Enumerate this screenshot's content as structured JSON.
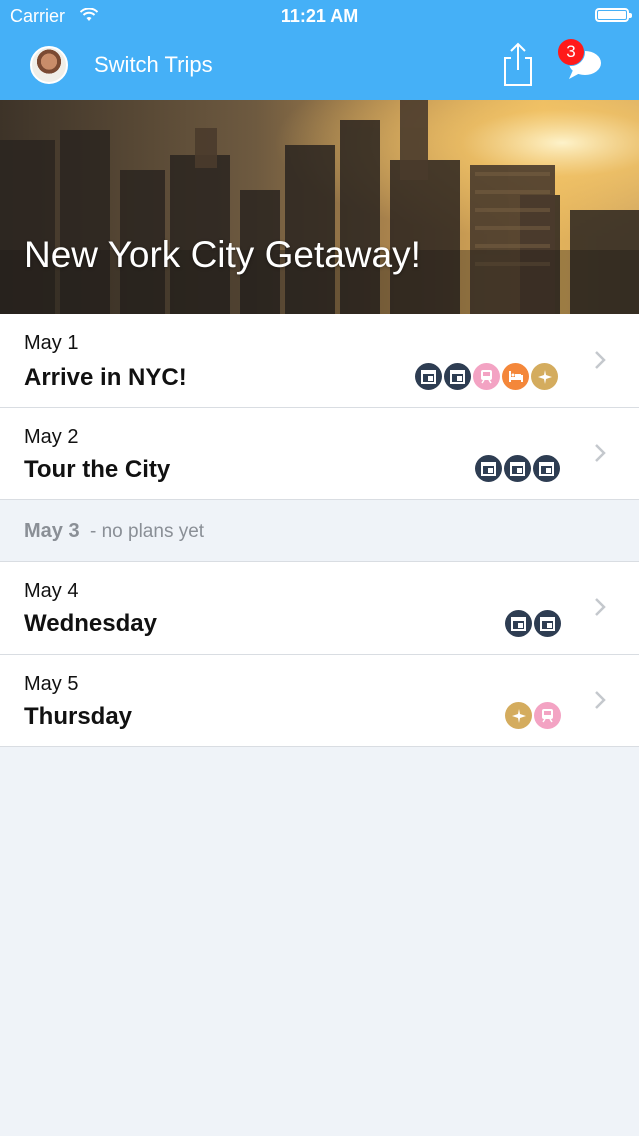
{
  "status_bar": {
    "carrier": "Carrier",
    "time": "11:21 AM"
  },
  "nav": {
    "title": "Switch Trips",
    "badge_count": "3"
  },
  "trip": {
    "title": "New York City Getaway!"
  },
  "days": [
    {
      "date": "May 1",
      "title": "Arrive in NYC!",
      "icons": [
        "calendar-icon",
        "calendar-icon",
        "train-icon",
        "hotel-icon",
        "plane-icon"
      ]
    },
    {
      "date": "May 2",
      "title": "Tour the City",
      "icons": [
        "calendar-icon",
        "calendar-icon",
        "calendar-icon"
      ]
    },
    {
      "date": "May 4",
      "title": "Wednesday",
      "icons": [
        "calendar-icon",
        "calendar-icon"
      ]
    },
    {
      "date": "May 5",
      "title": "Thursday",
      "icons": [
        "plane-icon",
        "train-icon"
      ]
    }
  ],
  "empty_day": {
    "date": "May 3",
    "note": "- no plans yet"
  },
  "colors": {
    "brand_blue": "#45b0f7",
    "calendar": "#2e3d52",
    "train": "#f3a3c3",
    "hotel": "#f4873a",
    "plane": "#d4ac5e",
    "badge": "#ff1a1a"
  }
}
